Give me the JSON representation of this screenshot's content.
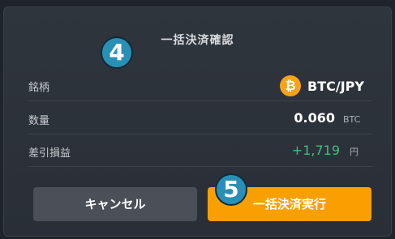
{
  "dialog": {
    "title": "一括決済確認",
    "steps": {
      "step4": "4",
      "step5": "5"
    }
  },
  "rows": {
    "pair": {
      "label": "銘柄",
      "icon": "bitcoin-icon",
      "icon_glyph": "₿",
      "value": "BTC/JPY"
    },
    "quantity": {
      "label": "数量",
      "value": "0.060",
      "unit": "BTC"
    },
    "pnl": {
      "label": "差引損益",
      "value": "+1,719",
      "unit": "円"
    }
  },
  "buttons": {
    "cancel": "キャンセル",
    "execute": "一括決済実行"
  },
  "colors": {
    "accent": "#f9a000",
    "profit": "#3dc07a",
    "step_marker": "#2a8fb4"
  }
}
